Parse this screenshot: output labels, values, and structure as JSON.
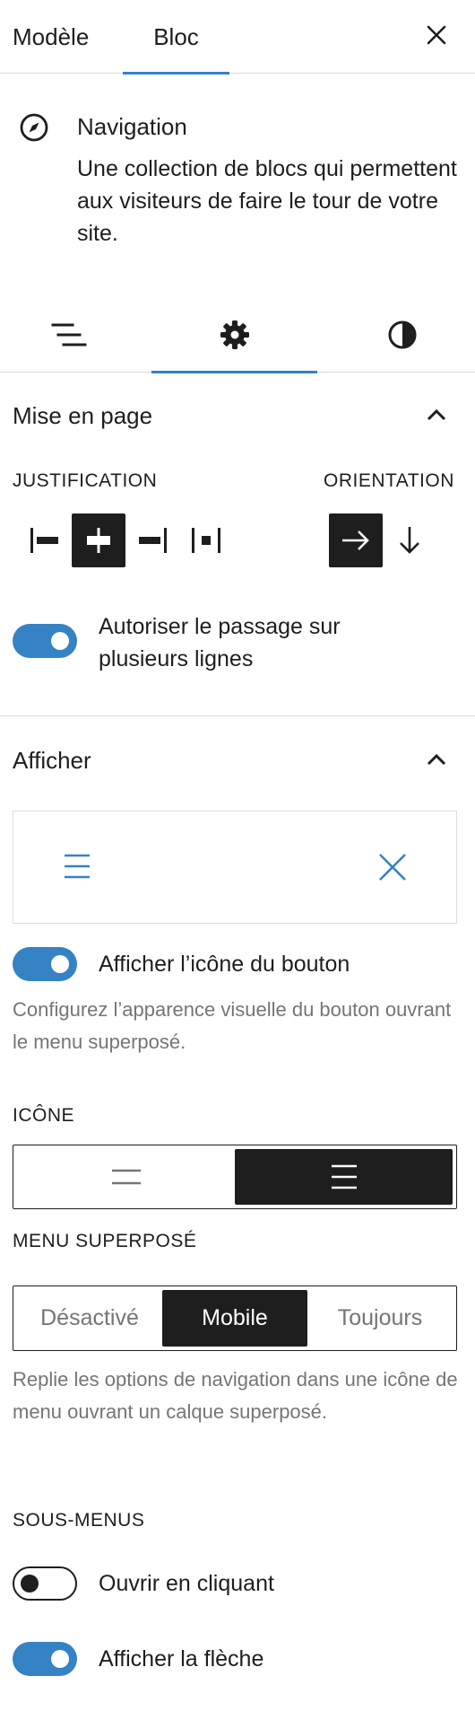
{
  "header": {
    "tabs": [
      {
        "label": "Modèle",
        "active": false
      },
      {
        "label": "Bloc",
        "active": true
      }
    ],
    "close_icon": "close-icon"
  },
  "block": {
    "icon": "compass-icon",
    "title": "Navigation",
    "description": "Une collection de blocs qui permettent aux visiteurs de faire le tour de votre site."
  },
  "inspector_tabs": [
    {
      "icon": "list-view-icon",
      "active": false
    },
    {
      "icon": "gear-icon",
      "active": true
    },
    {
      "icon": "styles-contrast-icon",
      "active": false
    }
  ],
  "layout": {
    "title": "Mise en page",
    "justification_label": "Justification",
    "orientation_label": "Orientation",
    "justification_options": [
      {
        "icon": "justify-left-icon",
        "selected": false
      },
      {
        "icon": "justify-center-icon",
        "selected": true
      },
      {
        "icon": "justify-right-icon",
        "selected": false
      },
      {
        "icon": "justify-space-between-icon",
        "selected": false
      }
    ],
    "orientation_options": [
      {
        "icon": "arrow-right-icon",
        "selected": true
      },
      {
        "icon": "arrow-down-icon",
        "selected": false
      }
    ],
    "wrap_toggle": {
      "label": "Autoriser le passage sur plusieurs lignes",
      "on": true
    }
  },
  "display": {
    "title": "Afficher",
    "preview_icons": [
      "menu-icon",
      "close-icon"
    ],
    "show_icon_toggle": {
      "label": "Afficher l’icône du bouton",
      "on": true
    },
    "show_icon_help": "Configurez l’apparence visuelle du bouton ouvrant le menu superposé.",
    "icon_label": "Icône",
    "icon_options": [
      {
        "icon": "two-lines-menu-icon",
        "selected": false
      },
      {
        "icon": "three-lines-menu-icon",
        "selected": true
      }
    ],
    "overlay_label": "Menu superposé",
    "overlay_options": [
      {
        "label": "Désactivé",
        "selected": false
      },
      {
        "label": "Mobile",
        "selected": true
      },
      {
        "label": "Toujours",
        "selected": false
      }
    ],
    "overlay_help": "Replie les options de navigation dans une icône de menu ouvrant un calque superposé.",
    "submenus_label": "Sous-menus",
    "open_on_click_toggle": {
      "label": "Ouvrir en cliquant",
      "on": false
    },
    "show_arrow_toggle": {
      "label": "Afficher la flèche",
      "on": true
    }
  },
  "colors": {
    "accent": "#3582c4",
    "dark": "#1e1e1e",
    "muted": "#757575",
    "border": "#dcdcde"
  }
}
